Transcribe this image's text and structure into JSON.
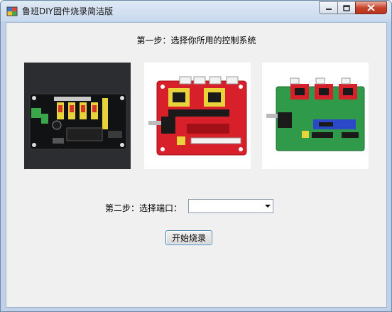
{
  "window": {
    "title": "鲁班DIY固件烧录简洁版"
  },
  "main": {
    "step1_label": "第一步：选择你所用的控制系统",
    "boards": [
      {
        "name": "black-controller-board"
      },
      {
        "name": "red-cnc-shield-board"
      },
      {
        "name": "green-nano-driver-board"
      }
    ],
    "step2_label": "第二步：选择端口：",
    "port_select": {
      "value": ""
    },
    "start_button": "开始烧录"
  }
}
